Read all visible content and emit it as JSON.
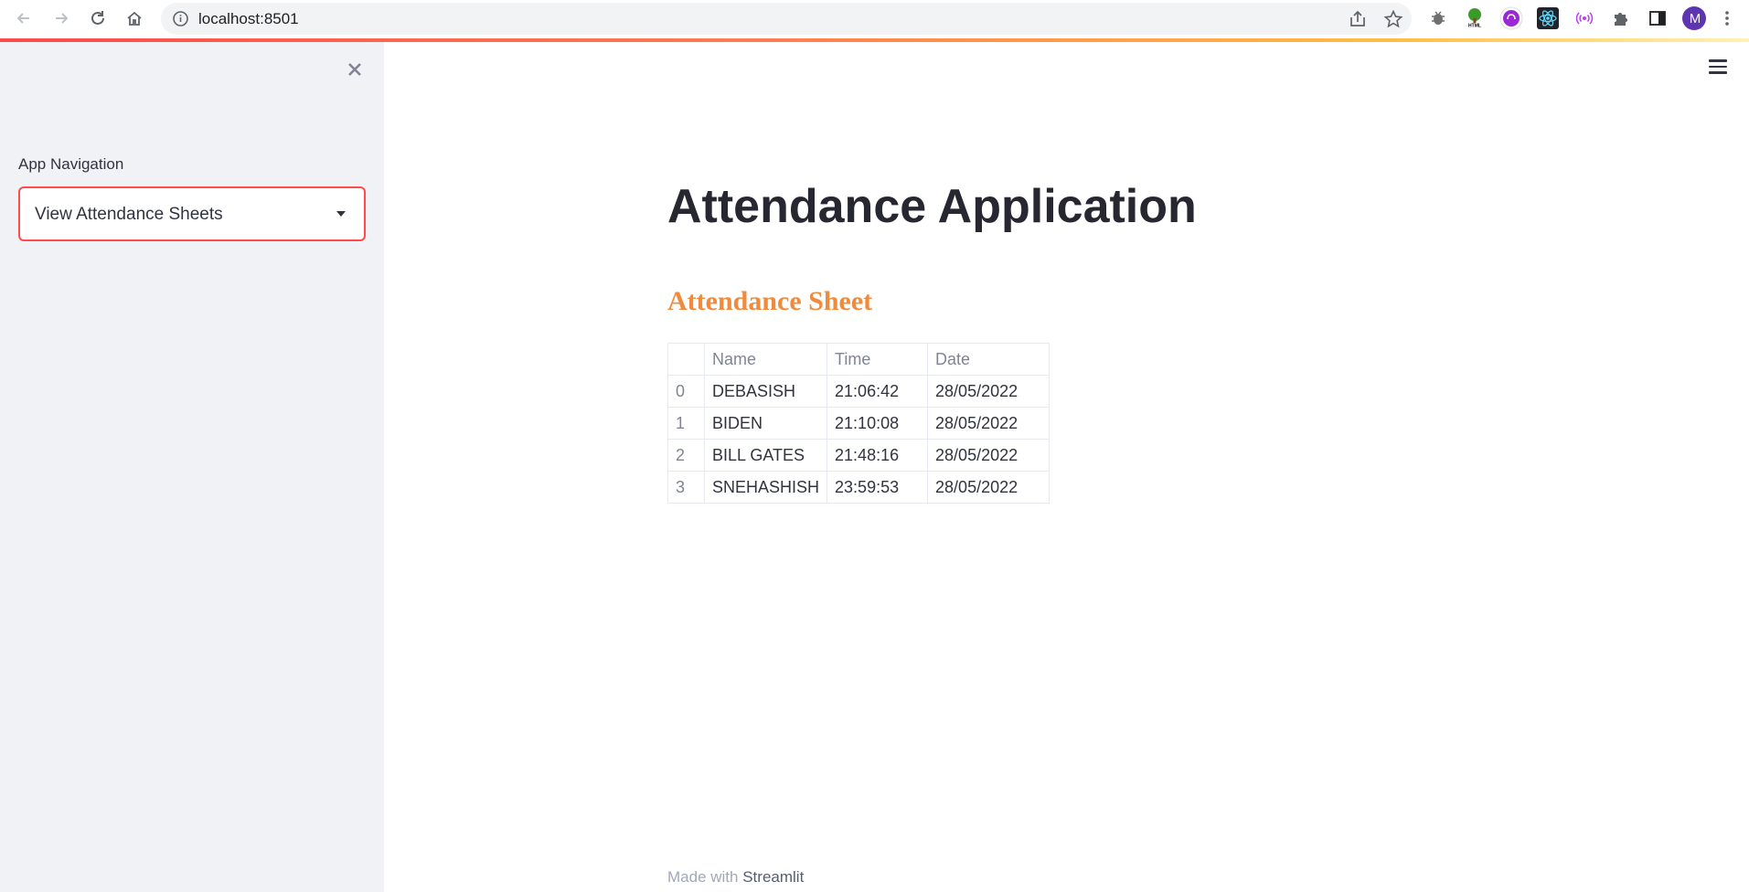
{
  "browser": {
    "url": "localhost:8501",
    "profile_initial": "M",
    "extensions": [
      "bug-icon",
      "tree-html-icon",
      "podcast-icon",
      "react-icon",
      "broadcast-icon",
      "puzzle-icon"
    ]
  },
  "sidebar": {
    "nav_label": "App Navigation",
    "selected_page": "View Attendance Sheets"
  },
  "main": {
    "title": "Attendance Application",
    "subtitle": "Attendance Sheet",
    "table": {
      "columns": [
        "",
        "Name",
        "Time",
        "Date"
      ],
      "rows": [
        {
          "index": "0",
          "name": "DEBASISH",
          "time": "21:06:42",
          "date": "28/05/2022"
        },
        {
          "index": "1",
          "name": "BIDEN",
          "time": "21:10:08",
          "date": "28/05/2022"
        },
        {
          "index": "2",
          "name": "BILL GATES",
          "time": "21:48:16",
          "date": "28/05/2022"
        },
        {
          "index": "3",
          "name": "SNEHASHISH",
          "time": "23:59:53",
          "date": "28/05/2022"
        }
      ]
    }
  },
  "footer": {
    "made_with": "Made with",
    "brand": "Streamlit"
  },
  "colors": {
    "accent": "#ff4b4b",
    "subtitle": "#f08a3c",
    "sidebar_bg": "#f0f2f6"
  }
}
